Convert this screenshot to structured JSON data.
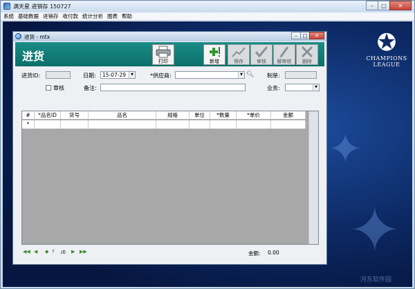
{
  "app": {
    "title": "满天星 进销存 150727",
    "window_buttons": {
      "minimize": "–",
      "maximize": "□",
      "close": "✕"
    }
  },
  "menu": [
    "系统",
    "基础数据",
    "进销存",
    "收付款",
    "统计分析",
    "图表",
    "帮助"
  ],
  "child_window": {
    "title": "进货 - mtx",
    "header_title": "进货",
    "toolbar": {
      "print": "打印",
      "new": "新增",
      "save": "保存",
      "audit": "审核",
      "unaudit": "解审核",
      "delete": "删除"
    },
    "form": {
      "invoice_id_label": "进货ID:",
      "invoice_id_value": "",
      "date_label": "日期:",
      "date_value": "15-07-29",
      "supplier_label": "*供应商:",
      "supplier_value": "",
      "maker_label": "制单:",
      "maker_value": "",
      "audit_label": "审核",
      "remark_label": "备注:",
      "remark_value": "",
      "salesman_label": "业务:",
      "salesman_value": ""
    },
    "grid": {
      "columns": [
        "#",
        "*品名ID",
        "货号",
        "品名",
        "规格",
        "单位",
        "*数量",
        "*单价",
        "金额"
      ],
      "new_row_marker": "*"
    },
    "status": {
      "page_info": "/0",
      "total_label": "金额:",
      "total_value": "0.00"
    }
  },
  "branding": {
    "ucl_line1": "CHAMPIONS",
    "ucl_line2": "LEAGUE",
    "watermark": "河东软件园"
  },
  "colors": {
    "header_band": "#0c6f69",
    "desktop_bg": "#0d2a66"
  }
}
